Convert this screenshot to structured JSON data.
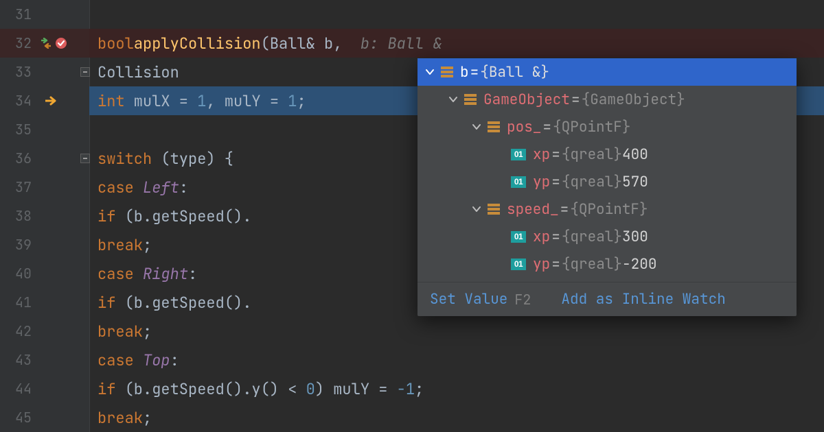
{
  "lines": [
    {
      "num": "31"
    },
    {
      "num": "32"
    },
    {
      "num": "33"
    },
    {
      "num": "34"
    },
    {
      "num": "35"
    },
    {
      "num": "36"
    },
    {
      "num": "37"
    },
    {
      "num": "38"
    },
    {
      "num": "39"
    },
    {
      "num": "40"
    },
    {
      "num": "41"
    },
    {
      "num": "42"
    },
    {
      "num": "43"
    },
    {
      "num": "44"
    },
    {
      "num": "45"
    }
  ],
  "code": {
    "l32": {
      "kw": "bool",
      "fn": "applyCollision",
      "open": "(",
      "param_type": "Ball&",
      "param_name": " b",
      "comma": ",",
      "inlay": "  b: Ball &"
    },
    "l33": {
      "text": "Collision"
    },
    "l34": {
      "kw": "int",
      "a": " mulX = ",
      "n1": "1",
      "b": ", mulY = ",
      "n2": "1",
      "semi": ";"
    },
    "l36": {
      "kw": "switch",
      "rest": " (type) {"
    },
    "l37": {
      "kw": "case ",
      "lbl": "Left",
      "colon": ":"
    },
    "l38": {
      "kw": "if",
      "rest": " (b.getSpeed()."
    },
    "l39": {
      "kw": "break",
      "semi": ";"
    },
    "l40": {
      "kw": "case ",
      "lbl": "Right",
      "colon": ":"
    },
    "l41": {
      "kw": "if",
      "rest": " (b.getSpeed()."
    },
    "l42": {
      "kw": "break",
      "semi": ";"
    },
    "l43": {
      "kw": "case ",
      "lbl": "Top",
      "colon": ":"
    },
    "l44": {
      "kw": "if",
      "a": " (b.getSpeed().y() < ",
      "n1": "0",
      "b": ") mulY = ",
      "n2": "-1",
      "semi": ";"
    },
    "l45": {
      "kw": "break",
      "semi": ";"
    }
  },
  "popup": {
    "rows": [
      {
        "depth": 0,
        "arrow": "down",
        "icon": "struct",
        "name": "b",
        "value": "{Ball &}",
        "top": true
      },
      {
        "depth": 1,
        "arrow": "down",
        "icon": "struct",
        "name": "GameObject",
        "value": "{GameObject}"
      },
      {
        "depth": 2,
        "arrow": "down",
        "icon": "struct",
        "name": "pos_",
        "value": "{QPointF}"
      },
      {
        "depth": 3,
        "arrow": "",
        "icon": "prim",
        "name": "xp",
        "value_type": "{qreal}",
        "value_plain": " 400"
      },
      {
        "depth": 3,
        "arrow": "",
        "icon": "prim",
        "name": "yp",
        "value_type": "{qreal}",
        "value_plain": " 570"
      },
      {
        "depth": 2,
        "arrow": "down",
        "icon": "struct",
        "name": "speed_",
        "value": "{QPointF}"
      },
      {
        "depth": 3,
        "arrow": "",
        "icon": "prim",
        "name": "xp",
        "value_type": "{qreal}",
        "value_plain": " 300"
      },
      {
        "depth": 3,
        "arrow": "",
        "icon": "prim",
        "name": "yp",
        "value_type": "{qreal}",
        "value_plain": " -200"
      }
    ],
    "footer": {
      "setValue": "Set Value",
      "setValueKey": "F2",
      "addWatch": "Add as Inline Watch"
    }
  },
  "icons": {
    "prim_label": "01"
  }
}
